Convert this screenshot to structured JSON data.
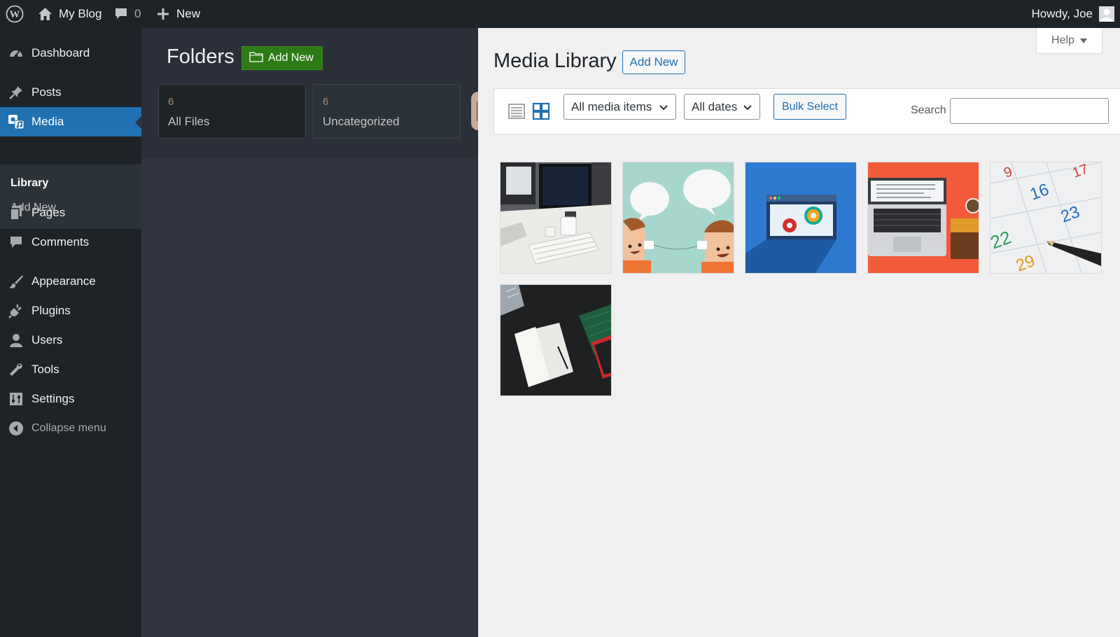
{
  "adminbar": {
    "site_name": "My Blog",
    "comments_count": "0",
    "new_label": "New",
    "greeting": "Howdy, Joe"
  },
  "menu": {
    "items": [
      {
        "label": "Dashboard",
        "icon": "dashboard-icon"
      },
      {
        "label": "Posts",
        "icon": "pin-icon"
      },
      {
        "label": "Media",
        "icon": "media-icon"
      },
      {
        "label": "Pages",
        "icon": "pages-icon"
      },
      {
        "label": "Comments",
        "icon": "comment-icon"
      },
      {
        "label": "Appearance",
        "icon": "brush-icon"
      },
      {
        "label": "Plugins",
        "icon": "plug-icon"
      },
      {
        "label": "Users",
        "icon": "user-icon"
      },
      {
        "label": "Tools",
        "icon": "wrench-icon"
      },
      {
        "label": "Settings",
        "icon": "sliders-icon"
      }
    ],
    "submenu": [
      {
        "label": "Library"
      },
      {
        "label": "Add New"
      }
    ],
    "collapse_label": "Collapse menu"
  },
  "folders": {
    "title": "Folders",
    "add_new_label": "Add New",
    "cards": [
      {
        "count": "6",
        "name": "All Files"
      },
      {
        "count": "6",
        "name": "Uncategorized"
      }
    ]
  },
  "main": {
    "help_label": "Help",
    "title": "Media Library",
    "add_new_label": "Add New",
    "filter_type": "All media items",
    "filter_dates": "All dates",
    "bulk_select_label": "Bulk Select",
    "search_label": "Search",
    "search_value": "",
    "media_items": [
      {
        "name": "desk-monitor-keyboard"
      },
      {
        "name": "chat-bubbles-people"
      },
      {
        "name": "settings-gears-window"
      },
      {
        "name": "laptop-top-view"
      },
      {
        "name": "calendar-pencil"
      },
      {
        "name": "notebook-desk"
      }
    ]
  },
  "colors": {
    "admin_bar": "#1d2327",
    "menu_current": "#2271b1",
    "folders_panel": "#2f3440",
    "add_folder_button": "#2e7a16",
    "accent": "#2271b1"
  }
}
